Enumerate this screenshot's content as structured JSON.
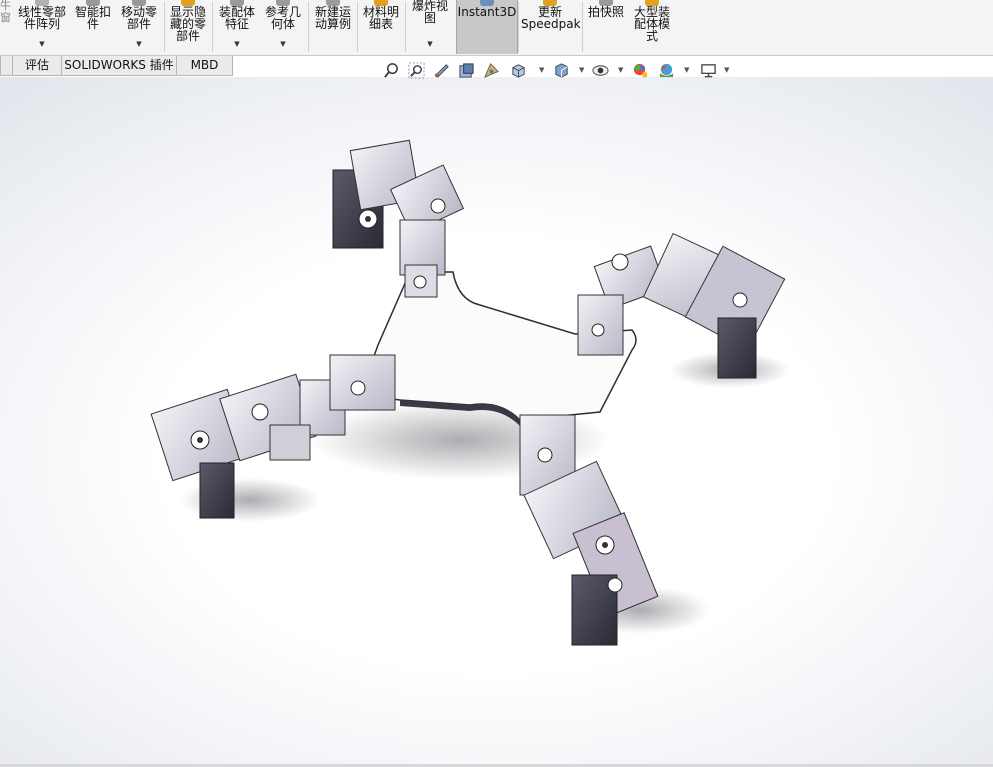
{
  "ribbon": {
    "items": [
      {
        "id": "linear",
        "label": "线性零部\n件阵列"
      },
      {
        "id": "smart",
        "label": "智能扣\n件"
      },
      {
        "id": "move",
        "label": "移动零\n部件"
      },
      {
        "id": "show",
        "label": "显示隐\n藏的零\n部件"
      },
      {
        "id": "asmfeat",
        "label": "装配体\n特征"
      },
      {
        "id": "refgeom",
        "label": "参考几\n何体"
      },
      {
        "id": "motion",
        "label": "新建运\n动算例"
      },
      {
        "id": "bom",
        "label": "材料明\n细表"
      },
      {
        "id": "explode",
        "label": "爆炸视\n图"
      },
      {
        "id": "instant3d",
        "label": "Instant3D"
      },
      {
        "id": "speedpak",
        "label": "更新\nSpeedpak"
      },
      {
        "id": "snapshot",
        "label": "拍快照"
      },
      {
        "id": "largeasm",
        "label": "大型装\n配体模\n式"
      }
    ],
    "left_clip": "牛\n窗"
  },
  "tabs": [
    "评估",
    "SOLIDWORKS 插件",
    "MBD"
  ],
  "hud_icons": [
    "zoom-to-fit-icon",
    "zoom-to-area-icon",
    "previous-view-icon",
    "section-view-icon",
    "dynamic-annotation-icon",
    "view-orientation-icon",
    "display-style-icon",
    "hide-show-items-icon",
    "edit-appearance-icon",
    "apply-scene-icon",
    "view-settings-icon"
  ],
  "colors": {
    "ribbon_bg": "#f4f4f4",
    "active_button": "#c8c8c8",
    "tab_bg": "#ebebeb",
    "metal_dark": "#3a3a48",
    "metal_light": "#e8e8ee",
    "plate": "#fbfbfb"
  }
}
